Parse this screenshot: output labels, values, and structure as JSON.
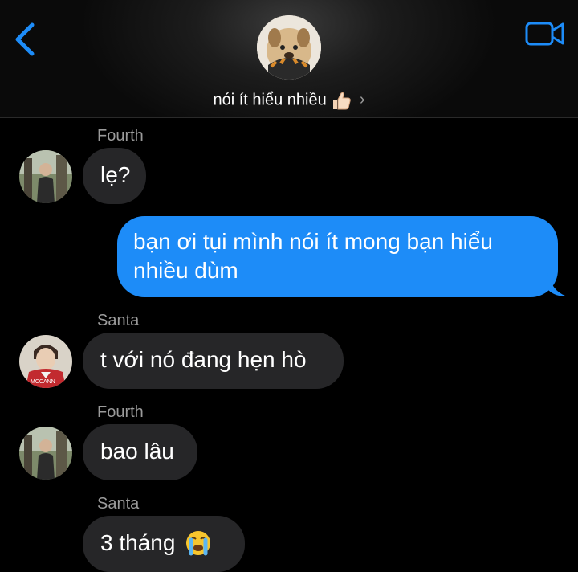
{
  "header": {
    "title": "nói ít hiểu nhiều",
    "title_emoji": "thumbs-up-icon",
    "chevron": "›",
    "back_icon": "chevron-left-icon",
    "video_icon": "video-camera-icon"
  },
  "colors": {
    "accent": "#1d8cf8",
    "incoming_bubble": "#262628",
    "sender_name": "#9b9b9b",
    "background": "#000000"
  },
  "messages": [
    {
      "sender": "Fourth",
      "text": "lẹ?",
      "direction": "incoming"
    },
    {
      "sender": "",
      "text": "bạn ơi tụi mình nói ít mong bạn hiểu nhiều dùm",
      "direction": "outgoing"
    },
    {
      "sender": "Santa",
      "text": "t với nó đang hẹn hò",
      "direction": "incoming"
    },
    {
      "sender": "Fourth",
      "text": "bao lâu",
      "direction": "incoming"
    },
    {
      "sender": "Santa",
      "text": "3 tháng",
      "emoji": "crying-face-icon",
      "direction": "incoming"
    }
  ],
  "avatars": {
    "santa_shirt_text": "MCCANN"
  }
}
